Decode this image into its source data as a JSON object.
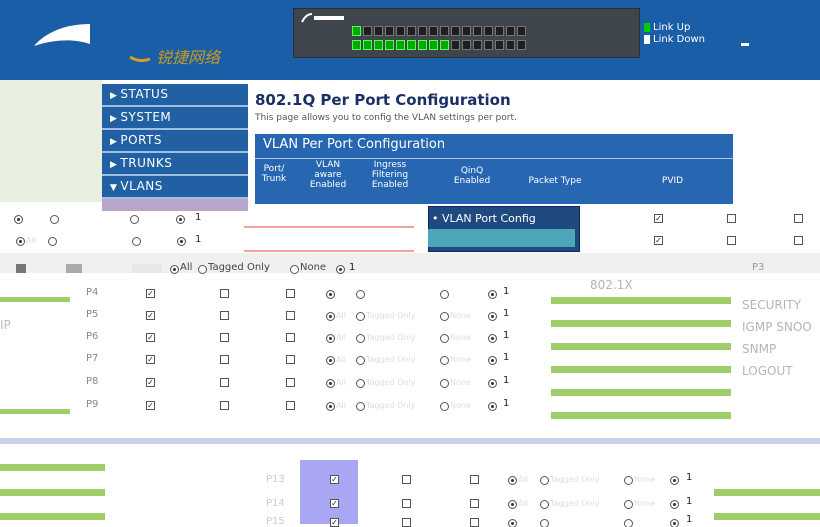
{
  "header": {
    "brand_small": "锐捷网络",
    "legend": {
      "up_label": "Link Up",
      "down_label": "Link Down"
    },
    "colors": {
      "bg": "#1a5ea8",
      "up": "#00cc00",
      "down": "#ffffff"
    }
  },
  "nav": {
    "items": [
      {
        "label": "STATUS",
        "icon": "triangle-right-icon"
      },
      {
        "label": "SYSTEM",
        "icon": "triangle-right-icon"
      },
      {
        "label": "PORTS",
        "icon": "triangle-right-icon"
      },
      {
        "label": "TRUNKS",
        "icon": "triangle-right-icon"
      },
      {
        "label": "VLANS",
        "icon": "triangle-down-icon"
      }
    ],
    "right_items": [
      "802.1X",
      "SECURITY",
      "IGMP SNOO",
      "SNMP",
      "LOGOUT"
    ],
    "left_fragment": "IP"
  },
  "page": {
    "title": "802.1Q Per Port Configuration",
    "description": "This page allows you to config the VLAN settings per port.",
    "panel_title": "VLAN Per Port Configuration",
    "columns": [
      "Port/ Trunk",
      "VLAN aware Enabled",
      "Ingress Filtering Enabled",
      "QinQ Enabled",
      "Packet Type",
      "PVID"
    ]
  },
  "dropdown": {
    "item": "• VLAN Port Config"
  },
  "packet_type": {
    "all": "All",
    "tagged": "Tagged Only",
    "none": "None"
  },
  "rows": [
    {
      "port": "P4",
      "pvid": "1"
    },
    {
      "port": "P5",
      "pvid": "1"
    },
    {
      "port": "P6",
      "pvid": "1"
    },
    {
      "port": "P7",
      "pvid": "1"
    },
    {
      "port": "P8",
      "pvid": "1"
    },
    {
      "port": "P9",
      "pvid": "1"
    }
  ],
  "lower_rows": [
    {
      "port": "P13",
      "pvid": "1"
    },
    {
      "port": "P14",
      "pvid": "1"
    },
    {
      "port": "P15",
      "pvid": "1"
    }
  ],
  "misc": {
    "p3": "P3",
    "pvid_small": "1"
  }
}
